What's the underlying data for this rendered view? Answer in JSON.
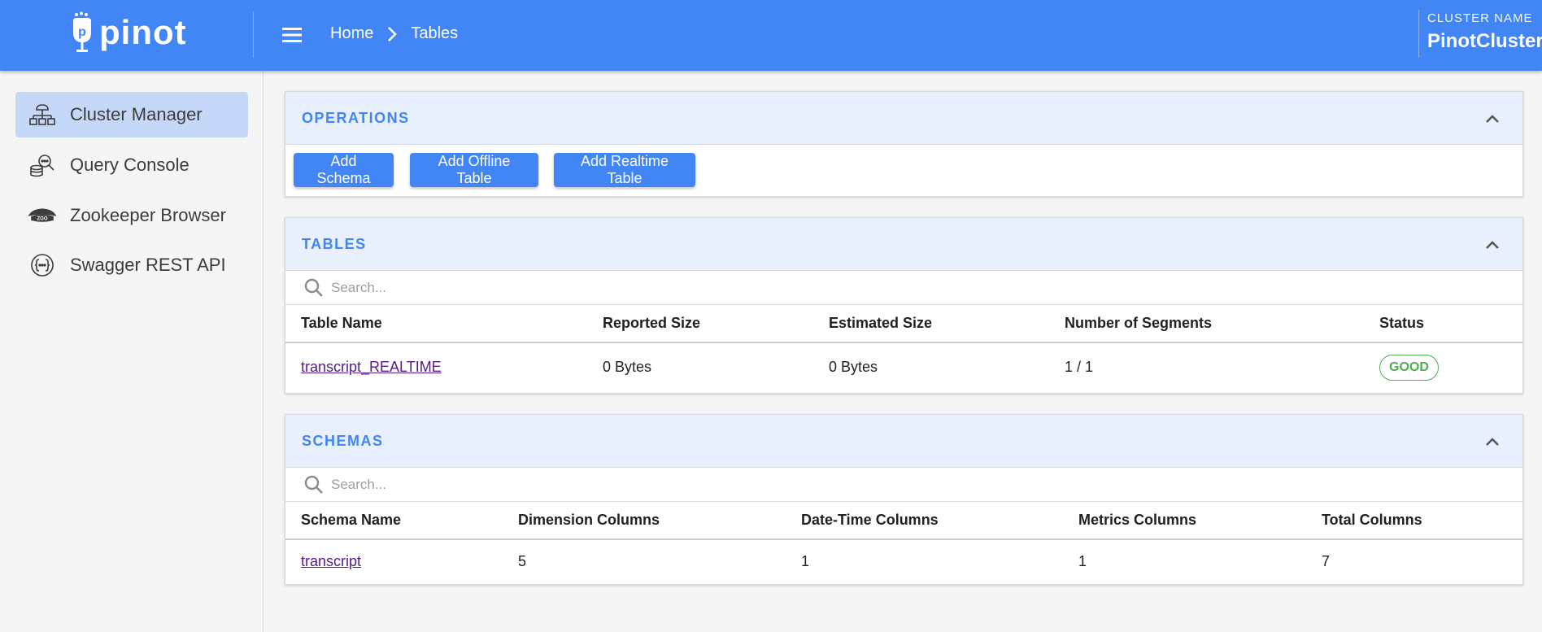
{
  "header": {
    "logo_text": "pinot",
    "breadcrumb": {
      "home": "Home",
      "current": "Tables"
    },
    "cluster_label": "CLUSTER NAME",
    "cluster_name": "PinotCluster"
  },
  "sidebar": {
    "items": [
      {
        "label": "Cluster Manager",
        "icon": "cluster-icon",
        "active": true
      },
      {
        "label": "Query Console",
        "icon": "query-icon",
        "active": false
      },
      {
        "label": "Zookeeper Browser",
        "icon": "zookeeper-icon",
        "active": false
      },
      {
        "label": "Swagger REST API",
        "icon": "api-icon",
        "active": false
      }
    ]
  },
  "operations": {
    "title": "OPERATIONS",
    "buttons": [
      "Add Schema",
      "Add Offline Table",
      "Add Realtime Table"
    ]
  },
  "tables": {
    "title": "TABLES",
    "search_placeholder": "Search...",
    "columns": [
      "Table Name",
      "Reported Size",
      "Estimated Size",
      "Number of Segments",
      "Status"
    ],
    "rows": [
      [
        "transcript_REALTIME",
        "0 Bytes",
        "0 Bytes",
        "1 / 1",
        "GOOD"
      ]
    ]
  },
  "schemas": {
    "title": "SCHEMAS",
    "search_placeholder": "Search...",
    "columns": [
      "Schema Name",
      "Dimension Columns",
      "Date-Time Columns",
      "Metrics Columns",
      "Total Columns"
    ],
    "rows": [
      [
        "transcript",
        "5",
        "1",
        "1",
        "7"
      ]
    ]
  },
  "colors": {
    "primary": "#4285f4",
    "card_header_bg": "#e8f0fd",
    "active_nav_bg": "#c5d8f8",
    "status_good": "#4caf50",
    "link": "#551a8b"
  }
}
